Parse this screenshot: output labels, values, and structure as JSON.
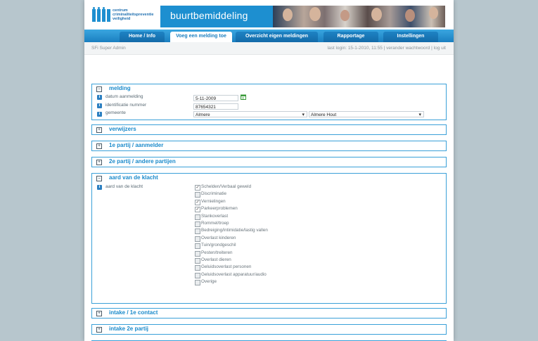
{
  "app": {
    "logo_text": [
      "centrum",
      "criminaliteitspreventie",
      "veiligheid"
    ],
    "banner_title": "buurtbemiddeling",
    "brand_color": "#1d8fd0"
  },
  "nav": {
    "tabs": [
      {
        "label": "Home / Info",
        "active": false
      },
      {
        "label": "Voeg een melding toe",
        "active": true
      },
      {
        "label": "Overzicht eigen meldingen",
        "active": false
      },
      {
        "label": "Rapportage",
        "active": false
      },
      {
        "label": "Instellingen",
        "active": false
      }
    ]
  },
  "subbar": {
    "user": "SFi Super Admin",
    "last_login": "last login: 15-1-2010, 11:55 |",
    "change_password": "verander wachtwoord",
    "separator": "|",
    "logout": "log uit"
  },
  "sections": {
    "melding": {
      "title": "melding",
      "toggle": "−",
      "rows": {
        "datum_label": "datum aanmelding",
        "datum_value": "5-11-2009",
        "nummer_label": "identificatie nummer",
        "nummer_value": "87654321",
        "gemeente_label": "gemeente",
        "gemeente_value": "Almere",
        "wijk_value": "Almere Hout"
      }
    },
    "verwijzers": {
      "title": "verwijzers",
      "toggle": "+"
    },
    "partij1": {
      "title": "1e partij / aanmelder",
      "toggle": "+"
    },
    "partij2": {
      "title": "2e partij / andere partijen",
      "toggle": "+"
    },
    "klacht": {
      "title": "aard van de klacht",
      "toggle": "−",
      "label": "aard van de klacht",
      "options": [
        {
          "label": "Schelden/Verbaal geweld",
          "checked": true
        },
        {
          "label": "Discriminatie",
          "checked": false
        },
        {
          "label": "Vernielingen",
          "checked": true
        },
        {
          "label": "Parkeerproblemen",
          "checked": true
        },
        {
          "label": "Stankoverlast",
          "checked": false
        },
        {
          "label": "Rommel/troep",
          "checked": false
        },
        {
          "label": "Bedreiging/intimidatie/lastig vallen",
          "checked": false
        },
        {
          "label": "Overlast kinderen",
          "checked": false
        },
        {
          "label": "Tuin/grondgeschil",
          "checked": false
        },
        {
          "label": "Pesten/treiteren",
          "checked": false
        },
        {
          "label": "Overlast dieren",
          "checked": false
        },
        {
          "label": "Geluidsoverlast personen",
          "checked": false
        },
        {
          "label": "Geluidsoverlast apparatuur/audio",
          "checked": false
        },
        {
          "label": "Overige",
          "checked": false
        }
      ]
    },
    "intake1": {
      "title": "intake / 1e contact",
      "toggle": "+"
    },
    "intake2": {
      "title": "intake 2e partij",
      "toggle": "+"
    }
  },
  "icons": {
    "info": "info-icon",
    "calendar": "calendar-icon",
    "checkmark": "✓"
  }
}
